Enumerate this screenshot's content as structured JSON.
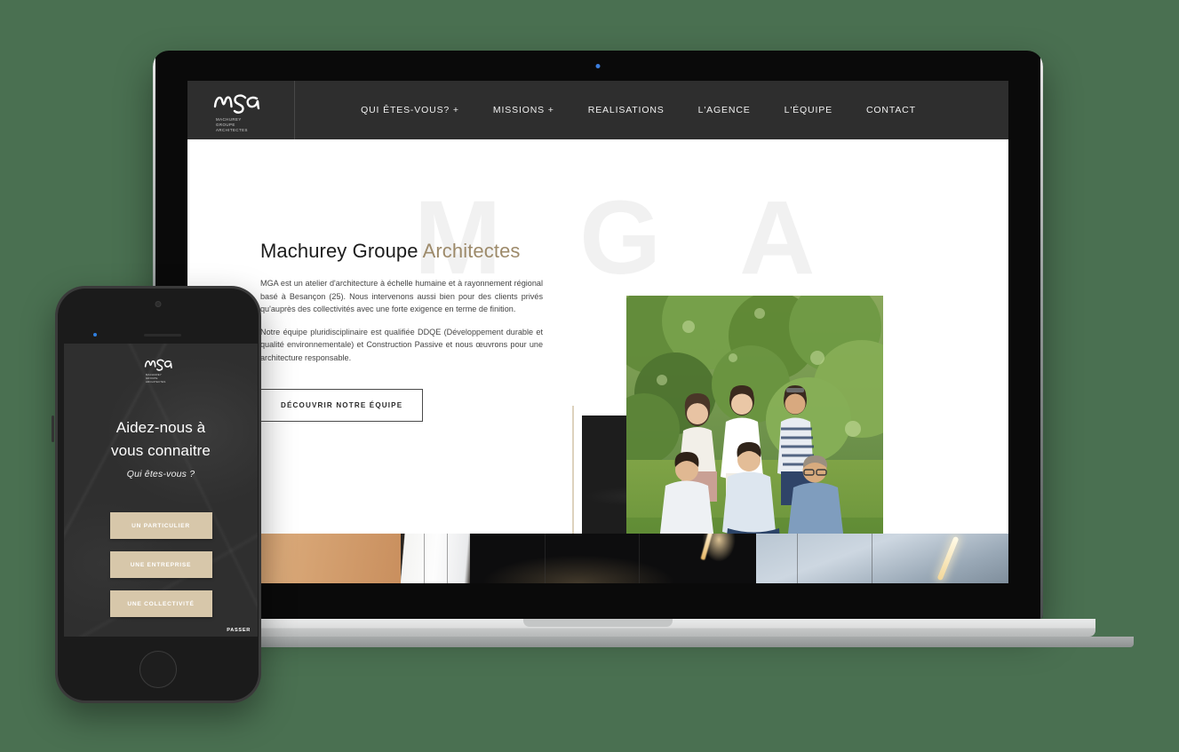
{
  "background_color": "#4a7051",
  "desktop": {
    "header": {
      "background": "#2e2e2e",
      "logo": {
        "wordmark": "mga",
        "line1": "MACHUREY",
        "line2": "GROUPE ARCHITECTES"
      },
      "nav": [
        {
          "label": "QUI ÊTES-VOUS? +"
        },
        {
          "label": "MISSIONS +"
        },
        {
          "label": "REALISATIONS"
        },
        {
          "label": "L'AGENCE"
        },
        {
          "label": "L'ÉQUIPE"
        },
        {
          "label": "CONTACT"
        }
      ]
    },
    "hero": {
      "watermark": "MGA",
      "title_main": "Machurey Groupe ",
      "title_accent": "Architectes",
      "accent_color": "#9d8a6a",
      "paragraph1": "MGA est un atelier d'architecture à échelle humaine et à rayonnement régional basé à Besançon (25). Nous intervenons aussi bien pour des clients privés qu'auprès des collectivités avec une forte exigence en terme de finition.",
      "paragraph2": "Notre équipe pluridisciplinaire est qualifiée DDQE (Développement durable et qualité environnementale) et Construction Passive et nous œuvrons pour une architecture responsable.",
      "cta_label": "DÉCOUVRIR NOTRE ÉQUIPE",
      "team_photo_alt": "Photo de l'équipe MGA dans un jardin"
    },
    "strip": {
      "panes": [
        "wood-interior",
        "white-corridor",
        "dark-kitchen",
        "blue-office"
      ]
    }
  },
  "mobile": {
    "logo": {
      "wordmark": "mga",
      "line1": "MACHUREY",
      "line2": "GROUPE ARCHITECTES"
    },
    "heading_line1": "Aidez-nous à",
    "heading_line2": "vous connaitre",
    "subtitle": "Qui êtes-vous ?",
    "button_color": "#d7c7aa",
    "buttons": [
      {
        "label": "UN PARTICULIER"
      },
      {
        "label": "UNE ENTREPRISE"
      },
      {
        "label": "UNE COLLECTIVITÉ"
      }
    ],
    "skip_label": "PASSER"
  }
}
